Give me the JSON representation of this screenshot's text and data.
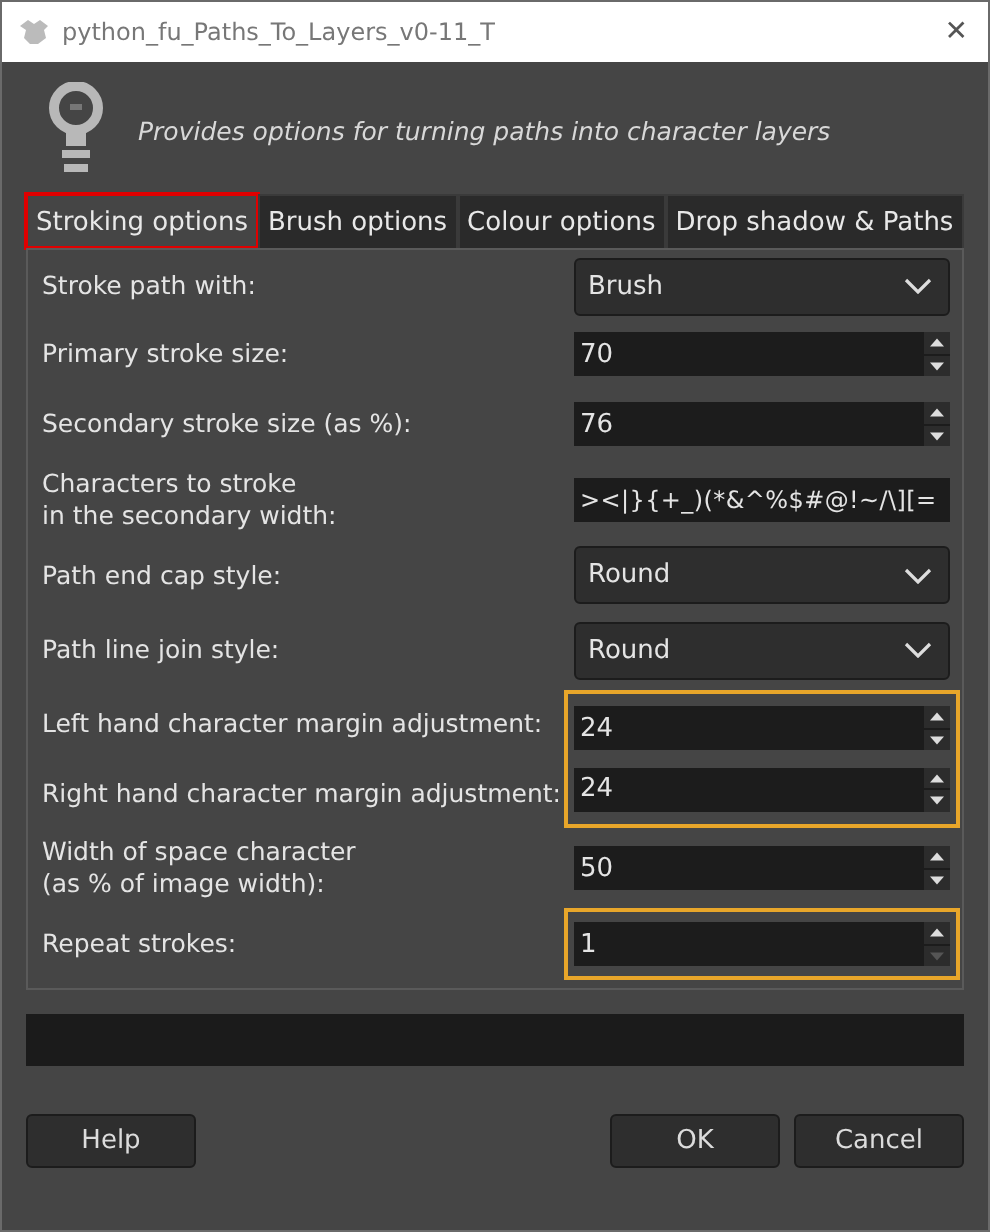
{
  "window": {
    "title": "python_fu_Paths_To_Layers_v0-11_T",
    "close": "✕"
  },
  "description": "Provides options for turning paths into character layers",
  "tabs": [
    {
      "label": "Stroking options",
      "selected": true,
      "highlighted": true
    },
    {
      "label": "Brush options",
      "selected": false,
      "highlighted": false
    },
    {
      "label": "Colour options",
      "selected": false,
      "highlighted": false
    },
    {
      "label": "Drop shadow & Paths",
      "selected": false,
      "highlighted": false
    }
  ],
  "rows": [
    {
      "kind": "combo",
      "label": "Stroke path with:",
      "value": "Brush",
      "highlighted": false
    },
    {
      "kind": "spin",
      "label": "Primary stroke size:",
      "value": "70",
      "highlighted": false,
      "down_disabled": false
    },
    {
      "kind": "spin",
      "label": "Secondary stroke size (as %):",
      "value": "76",
      "highlighted": false,
      "down_disabled": false
    },
    {
      "kind": "entry",
      "label": "Characters to stroke\nin the secondary width:",
      "value": "><|}{+_)(*&^%$#@!~/\\][=",
      "highlighted": false
    },
    {
      "kind": "combo",
      "label": "Path end cap style:",
      "value": "Round",
      "highlighted": false
    },
    {
      "kind": "combo",
      "label": "Path line join style:",
      "value": "Round",
      "highlighted": false
    },
    {
      "kind": "spin",
      "label": "Left hand character margin adjustment:",
      "value": "24",
      "highlighted": true,
      "down_disabled": false
    },
    {
      "kind": "spin",
      "label": "Right hand character margin adjustment:",
      "value": "24",
      "highlighted": true,
      "down_disabled": false
    },
    {
      "kind": "spin",
      "label": "Width of space character\n(as % of image width):",
      "value": "50",
      "highlighted": false,
      "down_disabled": false
    },
    {
      "kind": "spin",
      "label": "Repeat strokes:",
      "value": "1",
      "highlighted": true,
      "down_disabled": true
    }
  ],
  "buttons": {
    "left": [
      "Help"
    ],
    "right": [
      "OK",
      "Cancel"
    ]
  }
}
